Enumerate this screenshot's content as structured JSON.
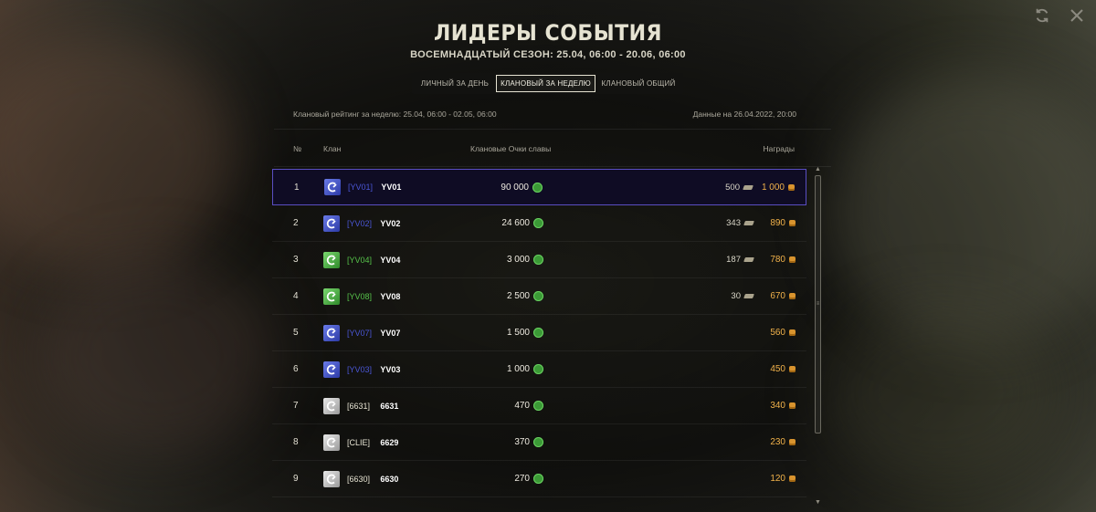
{
  "header": {
    "title": "ЛИДЕРЫ СОБЫТИЯ",
    "subtitle": "ВОСЕМНАДЦАТЫЙ СЕЗОН: 25.04, 06:00 - 20.06, 06:00"
  },
  "top_icons": [
    "refresh-icon",
    "close-icon"
  ],
  "tabs": [
    {
      "label": "ЛИЧНЫЙ ЗА ДЕНЬ",
      "active": false
    },
    {
      "label": "КЛАНОВЫЙ ЗА НЕДЕЛЮ",
      "active": true
    },
    {
      "label": "КЛАНОВЫЙ ОБЩИЙ",
      "active": false
    }
  ],
  "info": {
    "left": "Клановый рейтинг за неделю: 25.04, 06:00 - 02.05, 06:00",
    "right": "Данные на 26.04.2022, 20:00"
  },
  "columns": {
    "rank": "№",
    "clan": "Клан",
    "points": "Клановые Очки славы",
    "rewards": "Награды"
  },
  "colors": {
    "highlight_border": "#5a4ec2",
    "blue_tag": "#4a56d6",
    "green_tag": "#56c24a",
    "gold": "#f0b14a"
  },
  "rows": [
    {
      "rank": "1",
      "tag": "[YV01]",
      "name": "YV01",
      "points": "90 000",
      "bonds": "500",
      "gold": "1 000",
      "emblem": "blue"
    },
    {
      "rank": "2",
      "tag": "[YV02]",
      "name": "YV02",
      "points": "24 600",
      "bonds": "343",
      "gold": "890",
      "emblem": "blue"
    },
    {
      "rank": "3",
      "tag": "[YV04]",
      "name": "YV04",
      "points": "3 000",
      "bonds": "187",
      "gold": "780",
      "emblem": "green"
    },
    {
      "rank": "4",
      "tag": "[YV08]",
      "name": "YV08",
      "points": "2 500",
      "bonds": "30",
      "gold": "670",
      "emblem": "green"
    },
    {
      "rank": "5",
      "tag": "[YV07]",
      "name": "YV07",
      "points": "1 500",
      "bonds": "",
      "gold": "560",
      "emblem": "blue"
    },
    {
      "rank": "6",
      "tag": "[YV03]",
      "name": "YV03",
      "points": "1 000",
      "bonds": "",
      "gold": "450",
      "emblem": "blue"
    },
    {
      "rank": "7",
      "tag": "[6631]",
      "name": "6631",
      "points": "470",
      "bonds": "",
      "gold": "340",
      "emblem": "white"
    },
    {
      "rank": "8",
      "tag": "[CLIE]",
      "name": "6629",
      "points": "370",
      "bonds": "",
      "gold": "230",
      "emblem": "white"
    },
    {
      "rank": "9",
      "tag": "[6630]",
      "name": "6630",
      "points": "270",
      "bonds": "",
      "gold": "120",
      "emblem": "white"
    }
  ]
}
